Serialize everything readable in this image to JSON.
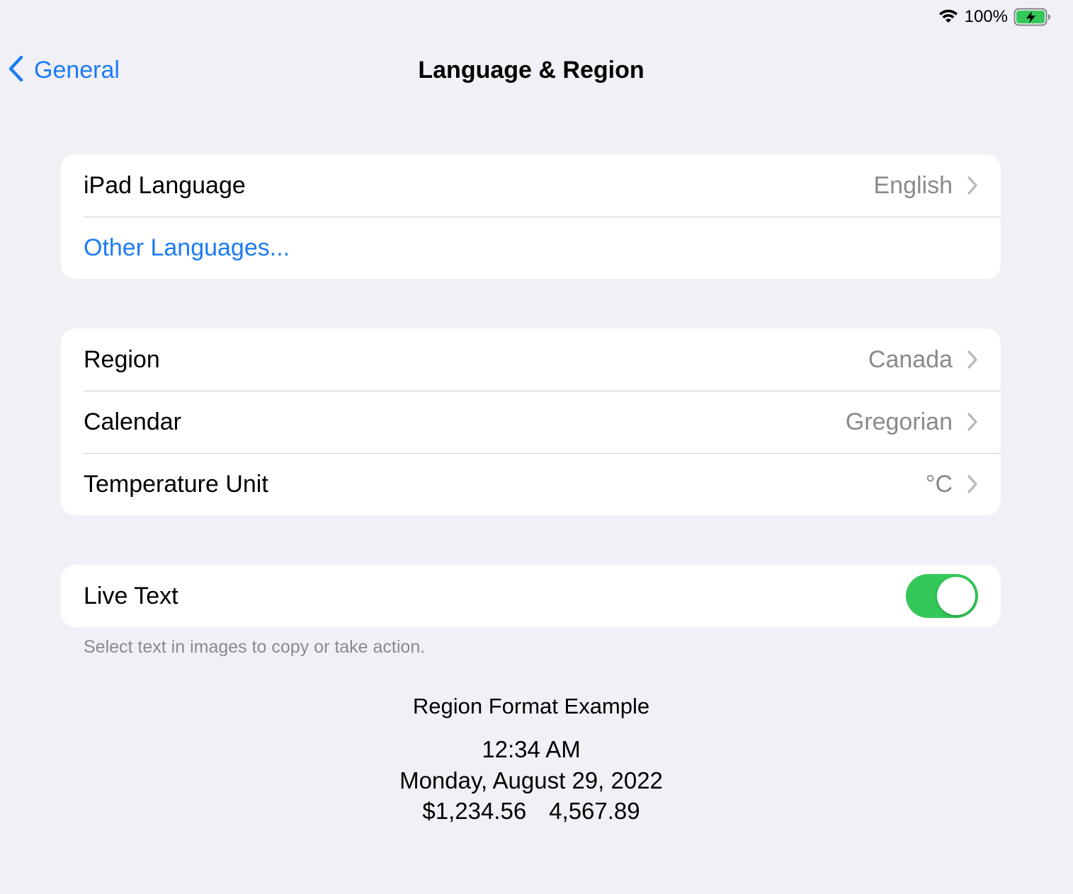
{
  "status_bar": {
    "battery_percent": "100%",
    "wifi": "wifi-icon",
    "battery": "battery-charging-icon",
    "battery_level": 1.0,
    "battery_color": "#34c759"
  },
  "nav": {
    "back_label": "General",
    "title": "Language & Region",
    "accent": "#1c7cf4"
  },
  "groups": {
    "language": {
      "ipad_language_label": "iPad Language",
      "ipad_language_value": "English",
      "other_languages_label": "Other Languages..."
    },
    "region": {
      "region_label": "Region",
      "region_value": "Canada",
      "calendar_label": "Calendar",
      "calendar_value": "Gregorian",
      "temperature_label": "Temperature Unit",
      "temperature_value": "°C"
    },
    "live_text": {
      "label": "Live Text",
      "enabled": true,
      "toggle_color": "#34c759",
      "footnote": "Select text in images to copy or take action."
    }
  },
  "region_format_example": {
    "title": "Region Format Example",
    "time": "12:34 AM",
    "date": "Monday, August 29, 2022",
    "currency": "$1,234.56",
    "number": "4,567.89"
  }
}
